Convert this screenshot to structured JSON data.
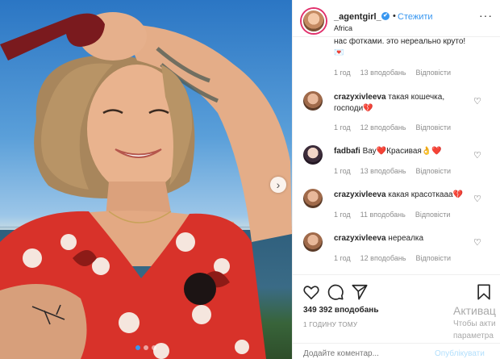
{
  "header": {
    "username": "_agentgirl_",
    "verified_mark": "✔",
    "follow_label": "Стежити",
    "location": "Africa",
    "more_label": "···"
  },
  "comments": {
    "partial_text": "нас фотками. это нереально круто!💌",
    "partial_meta": {
      "time": "1 год",
      "likes": "13 вподобань",
      "reply": "Відповісти"
    },
    "items": [
      {
        "user": "crazyxivleeva",
        "text": "такая кошечка, господи💔",
        "time": "1 год",
        "likes": "12 вподобань",
        "reply": "Відповісти"
      },
      {
        "user": "fadbafi",
        "text": "Вау❤️Красивая👌❤️",
        "time": "1 год",
        "likes": "13 вподобань",
        "reply": "Відповісти"
      },
      {
        "user": "crazyxivleeva",
        "text": "какая красоткааа💔",
        "time": "1 год",
        "likes": "11 вподобань",
        "reply": "Відповісти"
      },
      {
        "user": "crazyxivleeva",
        "text": "нереалка",
        "time": "1 год",
        "likes": "12 вподобань",
        "reply": "Відповісти"
      }
    ]
  },
  "icons": [
    "heart-icon",
    "comment-icon",
    "share-icon",
    "bookmark-icon",
    "chevron-right-icon",
    "more-icon"
  ],
  "footer": {
    "likes": "349 392 вподобань",
    "time": "1 ГОДИНУ ТОМУ",
    "comment_placeholder": "Додайте коментар...",
    "publish_label": "Опублікувати"
  },
  "watermark": {
    "line1": "Активац",
    "line2": "Чтобы акти",
    "line3": "параметра"
  },
  "colors": {
    "accent": "#3897f0",
    "muted": "#8e8e8e",
    "text": "#262626"
  }
}
